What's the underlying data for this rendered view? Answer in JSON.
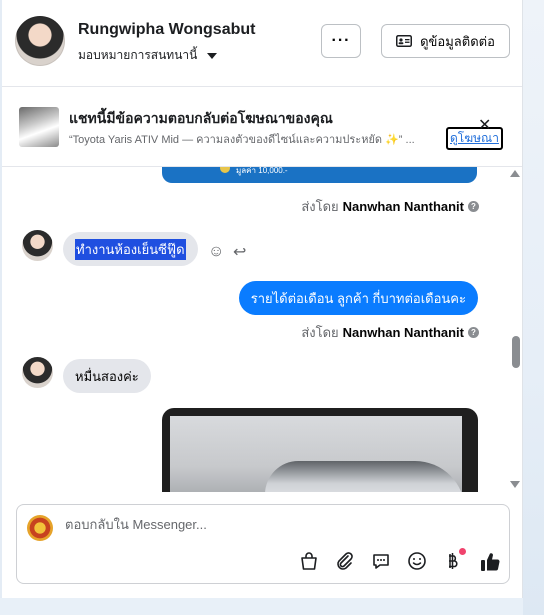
{
  "header": {
    "contact_name": "Rungwipha Wongsabut",
    "assignment_label": "มอบหมายการสนทนานี้",
    "more_label": "···",
    "view_contact_label": "ดูข้อมูลติดต่อ"
  },
  "ad": {
    "title": "แชทนี้มีข้อความตอบกลับต่อโฆษณาของคุณ",
    "subtitle": "“Toyota Yaris ATIV Mid — ความลงตัวของดีไซน์และความประหยัด ✨” ...",
    "link_label": "ดูโฆษณา",
    "close_label": "✕"
  },
  "messages": {
    "banner_text": "มูลค่า 10,000.-",
    "sent_by_prefix": "ส่งโดย",
    "sender_name": "Nanwhan Nanthanit",
    "incoming_1": "ทำงานห้องเย็นซีฟู๊ด",
    "outgoing_1": "รายได้ต่อเดือน ลูกค้า กี่บาทต่อเดือนคะ",
    "incoming_2": "หมื่นสองค่ะ"
  },
  "composer": {
    "placeholder": "ตอบกลับใน Messenger..."
  },
  "icons": {
    "more": "more-icon",
    "contact_card": "contact-card-icon",
    "info": "info-icon",
    "emoji": "emoji-icon",
    "reply": "reply-icon",
    "shop": "shopping-bag-icon",
    "attach": "paperclip-icon",
    "saved_reply": "chat-bubble-icon",
    "payment": "baht-icon",
    "like": "thumbs-up-icon"
  },
  "colors": {
    "outgoing_bubble": "#0a7cff",
    "incoming_bubble": "#e4e6eb",
    "link": "#216fdb",
    "selection": "#1f4fe0",
    "notify_dot": "#f0436d"
  }
}
